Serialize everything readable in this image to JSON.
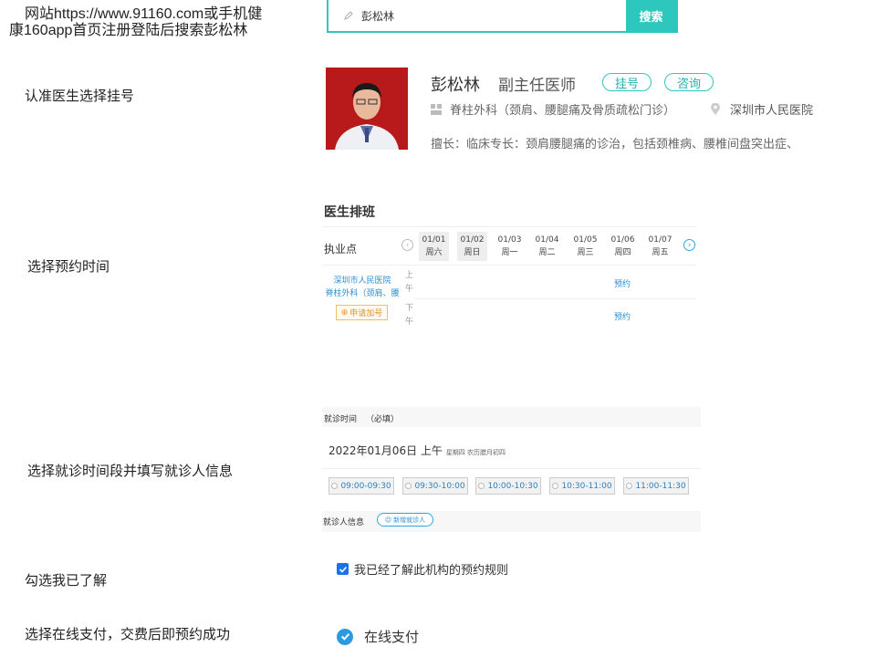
{
  "steps": {
    "s1_line1": "网站https://www.91160.com或手机健",
    "s1_line2": "康160app首页注册登陆后搜索彭松林",
    "s2": "认准医生选择挂号",
    "s3": "选择预约时间",
    "s4": "选择就诊时间段并填写就诊人信息",
    "s5": "勾选我已了解",
    "s6": "选择在线支付，交费后即预约成功"
  },
  "search": {
    "query": "彭松林",
    "button": "搜索",
    "accent": "#2ec7bd"
  },
  "doctor": {
    "name": "彭松林",
    "title": "副主任医师",
    "register_btn": "挂号",
    "consult_btn": "咨询",
    "dept": "脊柱外科（颈肩、腰腿痛及骨质疏松门诊）",
    "hospital": "深圳市人民医院",
    "skill": "擅长：临床专长：颈肩腰腿痛的诊治，包括颈椎病、腰椎间盘突出症、"
  },
  "schedule": {
    "title": "医生排班",
    "col_label": "执业点",
    "days": [
      {
        "date": "01/01",
        "week": "周六"
      },
      {
        "date": "01/02",
        "week": "周日"
      },
      {
        "date": "01/03",
        "week": "周一"
      },
      {
        "date": "01/04",
        "week": "周二"
      },
      {
        "date": "01/05",
        "week": "周三"
      },
      {
        "date": "01/06",
        "week": "周四"
      },
      {
        "date": "01/07",
        "week": "周五"
      }
    ],
    "hospital": "深圳市人民医院",
    "dept": "脊柱外科（颈肩、腰",
    "apply": "申请加号",
    "morning": "上午",
    "afternoon": "下午",
    "book": "预约"
  },
  "visit": {
    "header": "就诊时间",
    "required": "（必填）",
    "date": "2022年01月06日 上午",
    "date_extra": "星期四 农历腊月初四",
    "slots": [
      "09:00-09:30",
      "09:30-10:00",
      "10:00-10:30",
      "10:30-11:00",
      "11:00-11:30"
    ],
    "patient_label": "就诊人信息",
    "add_patient": "新增就诊人"
  },
  "agree": "我已经了解此机构的预约规则",
  "payment": "在线支付"
}
